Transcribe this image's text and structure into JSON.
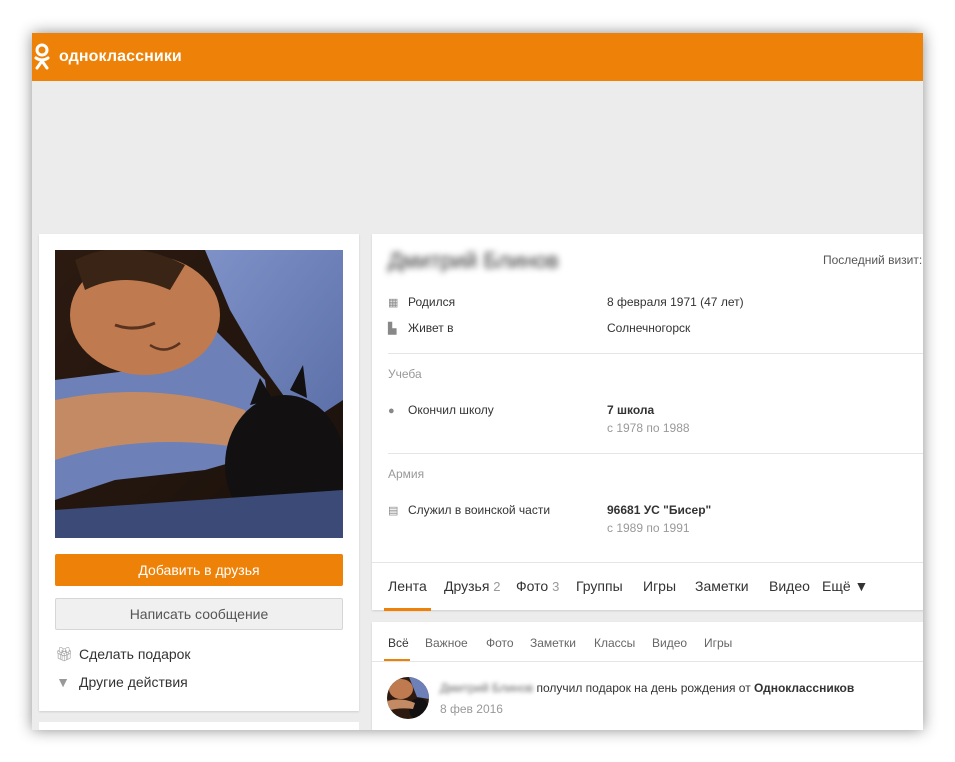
{
  "header": {
    "logo_text": "одноклассники",
    "logo_icon": "ok-logo-icon",
    "brand_color": "#ee8208"
  },
  "profile": {
    "name": "Дмитрий Блинов",
    "last_visit_label": "Последний визит:",
    "actions": {
      "add_friend": "Добавить в друзья",
      "send_message": "Написать сообщение",
      "make_gift": "Сделать подарок",
      "other_actions": "Другие действия"
    }
  },
  "info": {
    "born_label": "Родился",
    "born_value": "8 февраля 1971 (47 лет)",
    "lives_label": "Живет в",
    "lives_value": "Солнечногорск",
    "education_section": "Учеба",
    "school_label": "Окончил школу",
    "school_value": "7 школа",
    "school_years": "с 1978 по 1988",
    "army_section": "Армия",
    "army_label": "Служил в воинской части",
    "army_value": "96681 УС \"Бисер\"",
    "army_years": "с 1989 по 1991"
  },
  "tabs": [
    {
      "label": "Лента",
      "count": ""
    },
    {
      "label": "Друзья",
      "count": "2"
    },
    {
      "label": "Фото",
      "count": "3"
    },
    {
      "label": "Группы",
      "count": ""
    },
    {
      "label": "Игры",
      "count": ""
    },
    {
      "label": "Заметки",
      "count": ""
    },
    {
      "label": "Видео",
      "count": ""
    },
    {
      "label": "Ещё ▼",
      "count": ""
    }
  ],
  "feed": {
    "filters": [
      "Всё",
      "Важное",
      "Фото",
      "Заметки",
      "Классы",
      "Видео",
      "Игры"
    ],
    "item": {
      "author": "Дмитрий Блинов",
      "text": "получил подарок на день рождения от",
      "source": "Одноклассников",
      "date": "8 фев 2016"
    }
  }
}
